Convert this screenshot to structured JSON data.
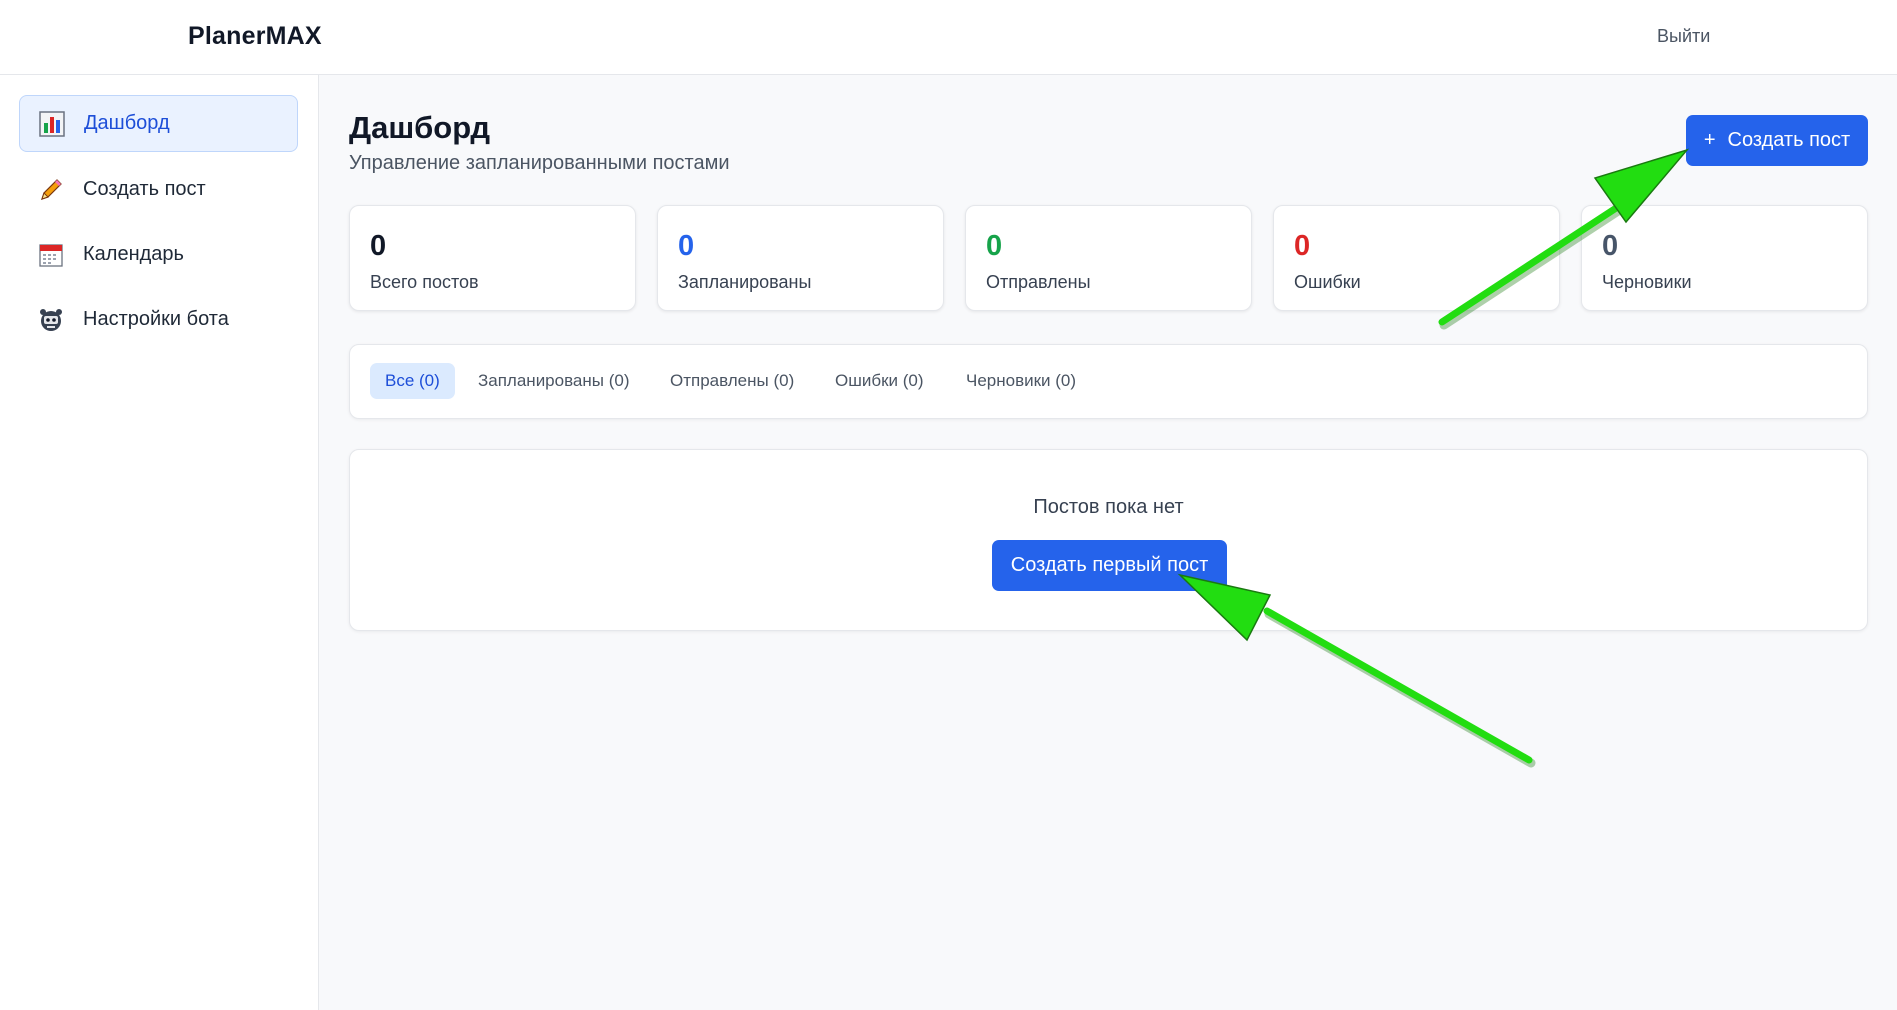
{
  "header": {
    "brand": "PlanerMAX",
    "logout_label": "Выйти"
  },
  "sidebar": {
    "items": [
      {
        "label": "Дашборд",
        "icon": "bar-chart-icon",
        "active": true
      },
      {
        "label": "Создать пост",
        "icon": "pencil-icon",
        "active": false
      },
      {
        "label": "Календарь",
        "icon": "calendar-icon",
        "active": false
      },
      {
        "label": "Настройки бота",
        "icon": "robot-icon",
        "active": false
      }
    ]
  },
  "page": {
    "title": "Дашборд",
    "subtitle": "Управление запланированными постами",
    "create_button": {
      "icon": "+",
      "label": "Создать пост"
    }
  },
  "stats": [
    {
      "value": "0",
      "label": "Всего постов",
      "color": "#111827"
    },
    {
      "value": "0",
      "label": "Запланированы",
      "color": "#2563eb"
    },
    {
      "value": "0",
      "label": "Отправлены",
      "color": "#16a34a"
    },
    {
      "value": "0",
      "label": "Ошибки",
      "color": "#dc2626"
    },
    {
      "value": "0",
      "label": "Черновики",
      "color": "#475569"
    }
  ],
  "filters": [
    {
      "label": "Все (0)",
      "active": true
    },
    {
      "label": "Запланированы (0)",
      "active": false
    },
    {
      "label": "Отправлены (0)",
      "active": false
    },
    {
      "label": "Ошибки (0)",
      "active": false
    },
    {
      "label": "Черновики (0)",
      "active": false
    }
  ],
  "empty_state": {
    "message": "Постов пока нет",
    "button_label": "Создать первый пост"
  },
  "theme": {
    "accent": "#2563eb",
    "annotation_arrow": "#22dd11"
  }
}
